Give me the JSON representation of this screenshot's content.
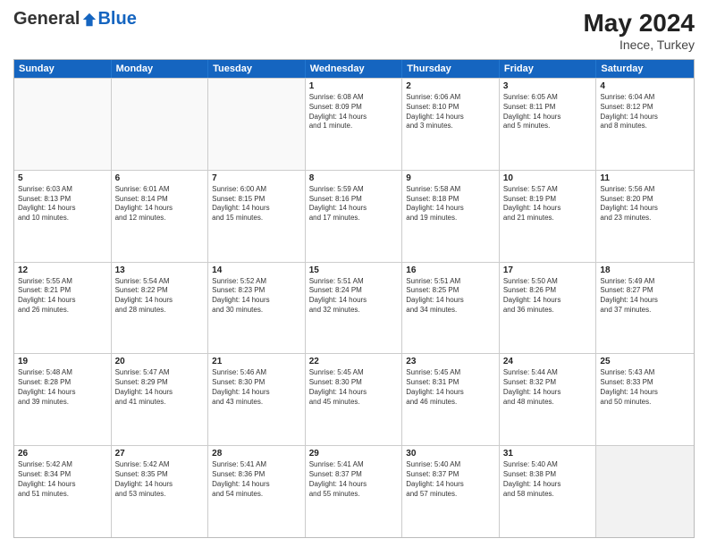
{
  "header": {
    "logo_general": "General",
    "logo_blue": "Blue",
    "month_year": "May 2024",
    "location": "Inece, Turkey"
  },
  "days_of_week": [
    "Sunday",
    "Monday",
    "Tuesday",
    "Wednesday",
    "Thursday",
    "Friday",
    "Saturday"
  ],
  "weeks": [
    [
      {
        "day": "",
        "info": ""
      },
      {
        "day": "",
        "info": ""
      },
      {
        "day": "",
        "info": ""
      },
      {
        "day": "1",
        "info": "Sunrise: 6:08 AM\nSunset: 8:09 PM\nDaylight: 14 hours\nand 1 minute."
      },
      {
        "day": "2",
        "info": "Sunrise: 6:06 AM\nSunset: 8:10 PM\nDaylight: 14 hours\nand 3 minutes."
      },
      {
        "day": "3",
        "info": "Sunrise: 6:05 AM\nSunset: 8:11 PM\nDaylight: 14 hours\nand 5 minutes."
      },
      {
        "day": "4",
        "info": "Sunrise: 6:04 AM\nSunset: 8:12 PM\nDaylight: 14 hours\nand 8 minutes."
      }
    ],
    [
      {
        "day": "5",
        "info": "Sunrise: 6:03 AM\nSunset: 8:13 PM\nDaylight: 14 hours\nand 10 minutes."
      },
      {
        "day": "6",
        "info": "Sunrise: 6:01 AM\nSunset: 8:14 PM\nDaylight: 14 hours\nand 12 minutes."
      },
      {
        "day": "7",
        "info": "Sunrise: 6:00 AM\nSunset: 8:15 PM\nDaylight: 14 hours\nand 15 minutes."
      },
      {
        "day": "8",
        "info": "Sunrise: 5:59 AM\nSunset: 8:16 PM\nDaylight: 14 hours\nand 17 minutes."
      },
      {
        "day": "9",
        "info": "Sunrise: 5:58 AM\nSunset: 8:18 PM\nDaylight: 14 hours\nand 19 minutes."
      },
      {
        "day": "10",
        "info": "Sunrise: 5:57 AM\nSunset: 8:19 PM\nDaylight: 14 hours\nand 21 minutes."
      },
      {
        "day": "11",
        "info": "Sunrise: 5:56 AM\nSunset: 8:20 PM\nDaylight: 14 hours\nand 23 minutes."
      }
    ],
    [
      {
        "day": "12",
        "info": "Sunrise: 5:55 AM\nSunset: 8:21 PM\nDaylight: 14 hours\nand 26 minutes."
      },
      {
        "day": "13",
        "info": "Sunrise: 5:54 AM\nSunset: 8:22 PM\nDaylight: 14 hours\nand 28 minutes."
      },
      {
        "day": "14",
        "info": "Sunrise: 5:52 AM\nSunset: 8:23 PM\nDaylight: 14 hours\nand 30 minutes."
      },
      {
        "day": "15",
        "info": "Sunrise: 5:51 AM\nSunset: 8:24 PM\nDaylight: 14 hours\nand 32 minutes."
      },
      {
        "day": "16",
        "info": "Sunrise: 5:51 AM\nSunset: 8:25 PM\nDaylight: 14 hours\nand 34 minutes."
      },
      {
        "day": "17",
        "info": "Sunrise: 5:50 AM\nSunset: 8:26 PM\nDaylight: 14 hours\nand 36 minutes."
      },
      {
        "day": "18",
        "info": "Sunrise: 5:49 AM\nSunset: 8:27 PM\nDaylight: 14 hours\nand 37 minutes."
      }
    ],
    [
      {
        "day": "19",
        "info": "Sunrise: 5:48 AM\nSunset: 8:28 PM\nDaylight: 14 hours\nand 39 minutes."
      },
      {
        "day": "20",
        "info": "Sunrise: 5:47 AM\nSunset: 8:29 PM\nDaylight: 14 hours\nand 41 minutes."
      },
      {
        "day": "21",
        "info": "Sunrise: 5:46 AM\nSunset: 8:30 PM\nDaylight: 14 hours\nand 43 minutes."
      },
      {
        "day": "22",
        "info": "Sunrise: 5:45 AM\nSunset: 8:30 PM\nDaylight: 14 hours\nand 45 minutes."
      },
      {
        "day": "23",
        "info": "Sunrise: 5:45 AM\nSunset: 8:31 PM\nDaylight: 14 hours\nand 46 minutes."
      },
      {
        "day": "24",
        "info": "Sunrise: 5:44 AM\nSunset: 8:32 PM\nDaylight: 14 hours\nand 48 minutes."
      },
      {
        "day": "25",
        "info": "Sunrise: 5:43 AM\nSunset: 8:33 PM\nDaylight: 14 hours\nand 50 minutes."
      }
    ],
    [
      {
        "day": "26",
        "info": "Sunrise: 5:42 AM\nSunset: 8:34 PM\nDaylight: 14 hours\nand 51 minutes."
      },
      {
        "day": "27",
        "info": "Sunrise: 5:42 AM\nSunset: 8:35 PM\nDaylight: 14 hours\nand 53 minutes."
      },
      {
        "day": "28",
        "info": "Sunrise: 5:41 AM\nSunset: 8:36 PM\nDaylight: 14 hours\nand 54 minutes."
      },
      {
        "day": "29",
        "info": "Sunrise: 5:41 AM\nSunset: 8:37 PM\nDaylight: 14 hours\nand 55 minutes."
      },
      {
        "day": "30",
        "info": "Sunrise: 5:40 AM\nSunset: 8:37 PM\nDaylight: 14 hours\nand 57 minutes."
      },
      {
        "day": "31",
        "info": "Sunrise: 5:40 AM\nSunset: 8:38 PM\nDaylight: 14 hours\nand 58 minutes."
      },
      {
        "day": "",
        "info": ""
      }
    ]
  ]
}
